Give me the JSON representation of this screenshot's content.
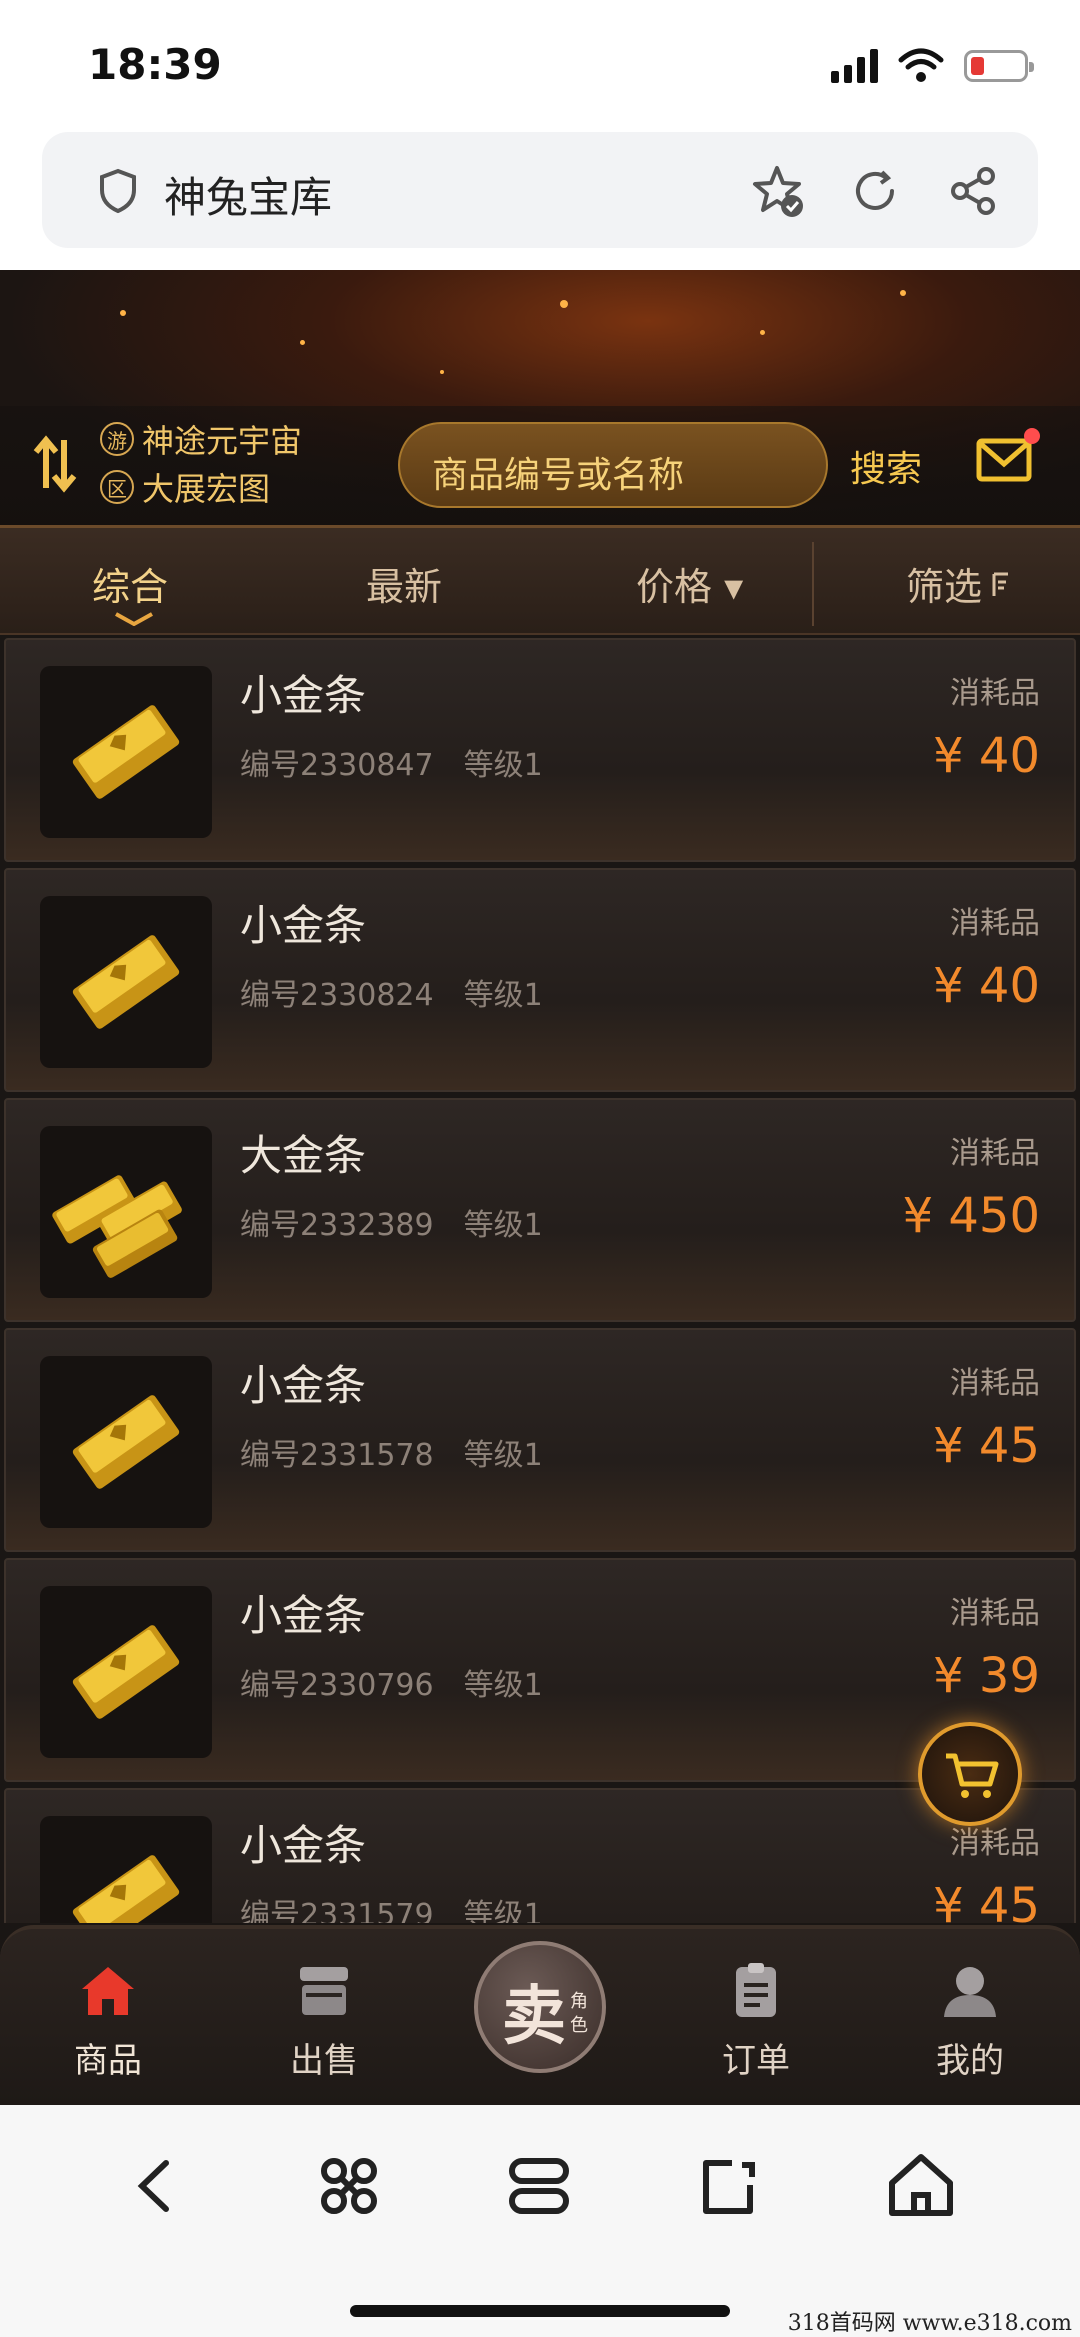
{
  "status_bar": {
    "time": "18:39"
  },
  "browser": {
    "title": "神兔宝库"
  },
  "header": {
    "game_tag": "游",
    "game_name": "神途元宇宙",
    "server_tag": "区",
    "server_name": "大展宏图",
    "search_placeholder": "商品编号或名称",
    "search_button": "搜索"
  },
  "tabs": [
    {
      "label": "综合",
      "active": true
    },
    {
      "label": "最新"
    },
    {
      "label": "价格 ▾"
    },
    {
      "label": "筛选"
    }
  ],
  "items": [
    {
      "name": "小金条",
      "id_label": "编号2330847",
      "level_label": "等级1",
      "category": "消耗品",
      "price": "¥ 40",
      "icon": "gold-bar-icon"
    },
    {
      "name": "小金条",
      "id_label": "编号2330824",
      "level_label": "等级1",
      "category": "消耗品",
      "price": "¥ 40",
      "icon": "gold-bar-icon"
    },
    {
      "name": "大金条",
      "id_label": "编号2332389",
      "level_label": "等级1",
      "category": "消耗品",
      "price": "¥ 450",
      "icon": "gold-bars-stack-icon"
    },
    {
      "name": "小金条",
      "id_label": "编号2331578",
      "level_label": "等级1",
      "category": "消耗品",
      "price": "¥ 45",
      "icon": "gold-bar-icon"
    },
    {
      "name": "小金条",
      "id_label": "编号2330796",
      "level_label": "等级1",
      "category": "消耗品",
      "price": "¥ 39",
      "icon": "gold-bar-icon"
    },
    {
      "name": "小金条",
      "id_label": "编号2331579",
      "level_label": "等级1",
      "category": "消耗品",
      "price": "¥ 45",
      "icon": "gold-bar-icon"
    }
  ],
  "bottom_nav": {
    "goods": "商品",
    "sell_list": "出售",
    "sell_big": "卖",
    "sell_small_1": "角",
    "sell_small_2": "色",
    "orders": "订单",
    "mine": "我的"
  },
  "watermark": "318首码网 www.e318.com",
  "colors": {
    "accent": "#f28a2c",
    "gold": "#f3d28a",
    "background": "#1a1614"
  }
}
